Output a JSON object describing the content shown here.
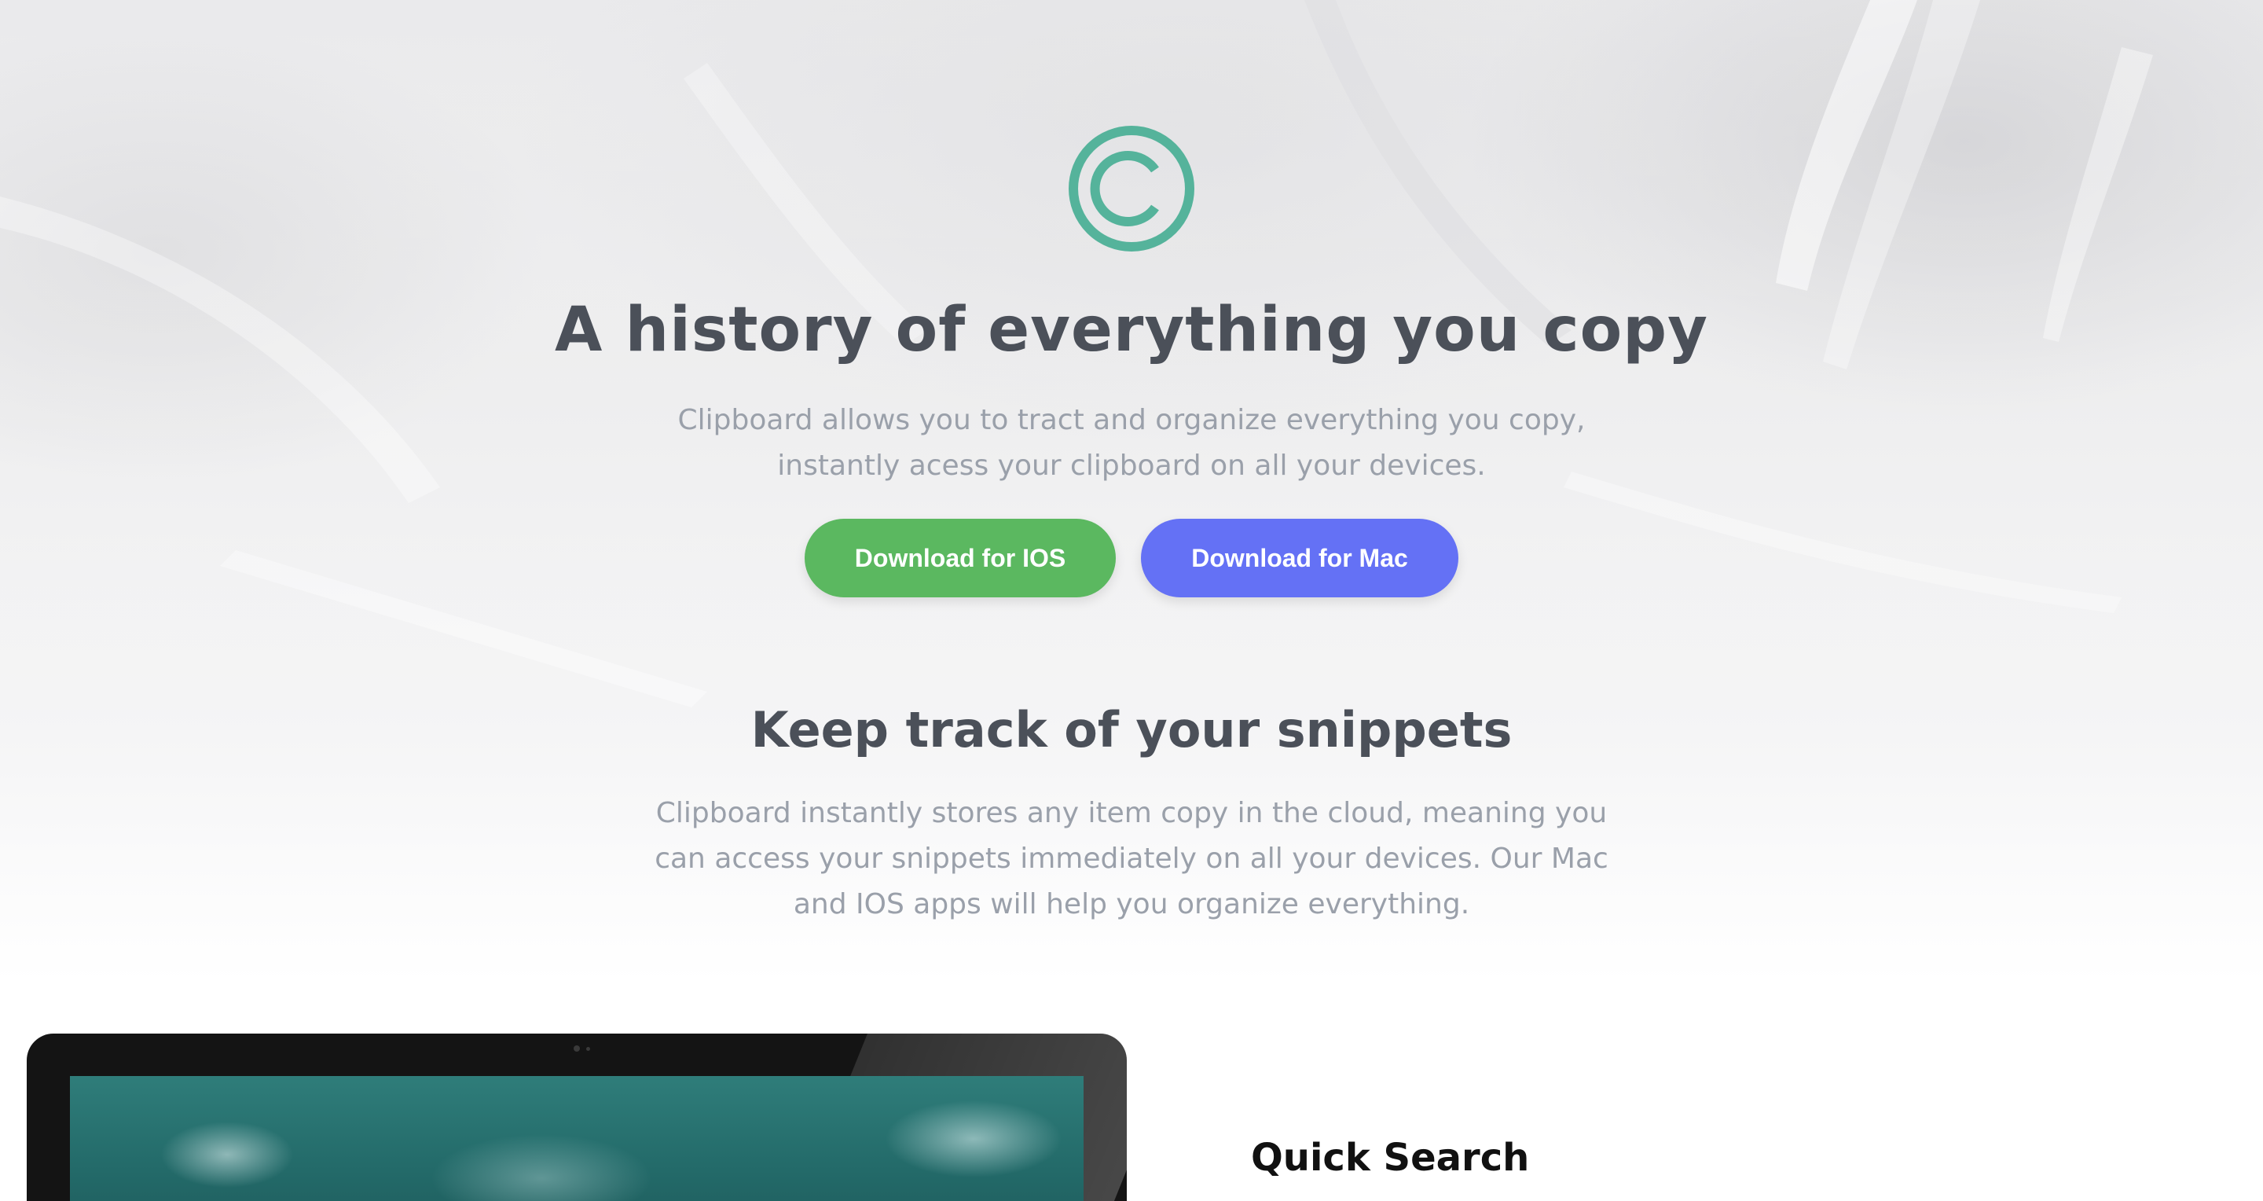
{
  "hero": {
    "title": "A history of everything you copy",
    "subtitle": "Clipboard allows you to tract and organize everything you copy, instantly acess your clipboard on all your devices.",
    "buttons": {
      "ios": "Download for IOS",
      "mac": "Download for Mac"
    }
  },
  "snippets": {
    "title": "Keep track of your snippets",
    "body": "Clipboard instantly stores any item copy in the cloud, meaning you can access your snippets immediately on all your devices. Our Mac and IOS apps will help you organize everything."
  },
  "features": {
    "first_title": "Quick Search"
  },
  "icons": {
    "logo": "copyright-c-logo-icon"
  },
  "colors": {
    "logo": "#55b39b",
    "heading": "#4b5059",
    "body_text": "#9aa0aa",
    "ios_button": "#5bb860",
    "mac_button": "#6471f5"
  }
}
